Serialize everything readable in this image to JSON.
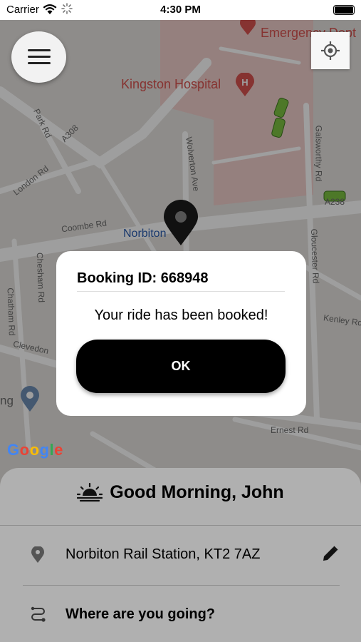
{
  "status_bar": {
    "carrier": "Carrier",
    "time": "4:30 PM"
  },
  "map": {
    "labels": {
      "kingston_hospital": "Kingston Hospital",
      "emergency": "Emergency Dept",
      "norbiton": "Norbiton",
      "park_rd": "Park Rd",
      "a308": "A308",
      "london_rd": "London Rd",
      "coombe_rd": "Coombe Rd",
      "wolverton_ave": "Wolverton Ave",
      "galsworthy_rd": "Galsworthy Rd",
      "gloucester_rd": "Gloucester Rd",
      "kenley_rd": "Kenley Rd",
      "cheshan_rd": "Chesham Rd",
      "chatham_rd": "Chatham Rd",
      "clevedon": "Clevedon",
      "ernest_rd": "Ernest Rd",
      "a238": "A238",
      "ng": "ng"
    },
    "google_logo": "Google"
  },
  "dialog": {
    "title": "Booking ID: 668948",
    "message": "Your ride has been booked!",
    "ok_label": "OK"
  },
  "panel": {
    "greeting": "Good Morning, John",
    "pickup": "Norbiton Rail Station, KT2 7AZ",
    "destination_placeholder": "Where are you going?"
  }
}
